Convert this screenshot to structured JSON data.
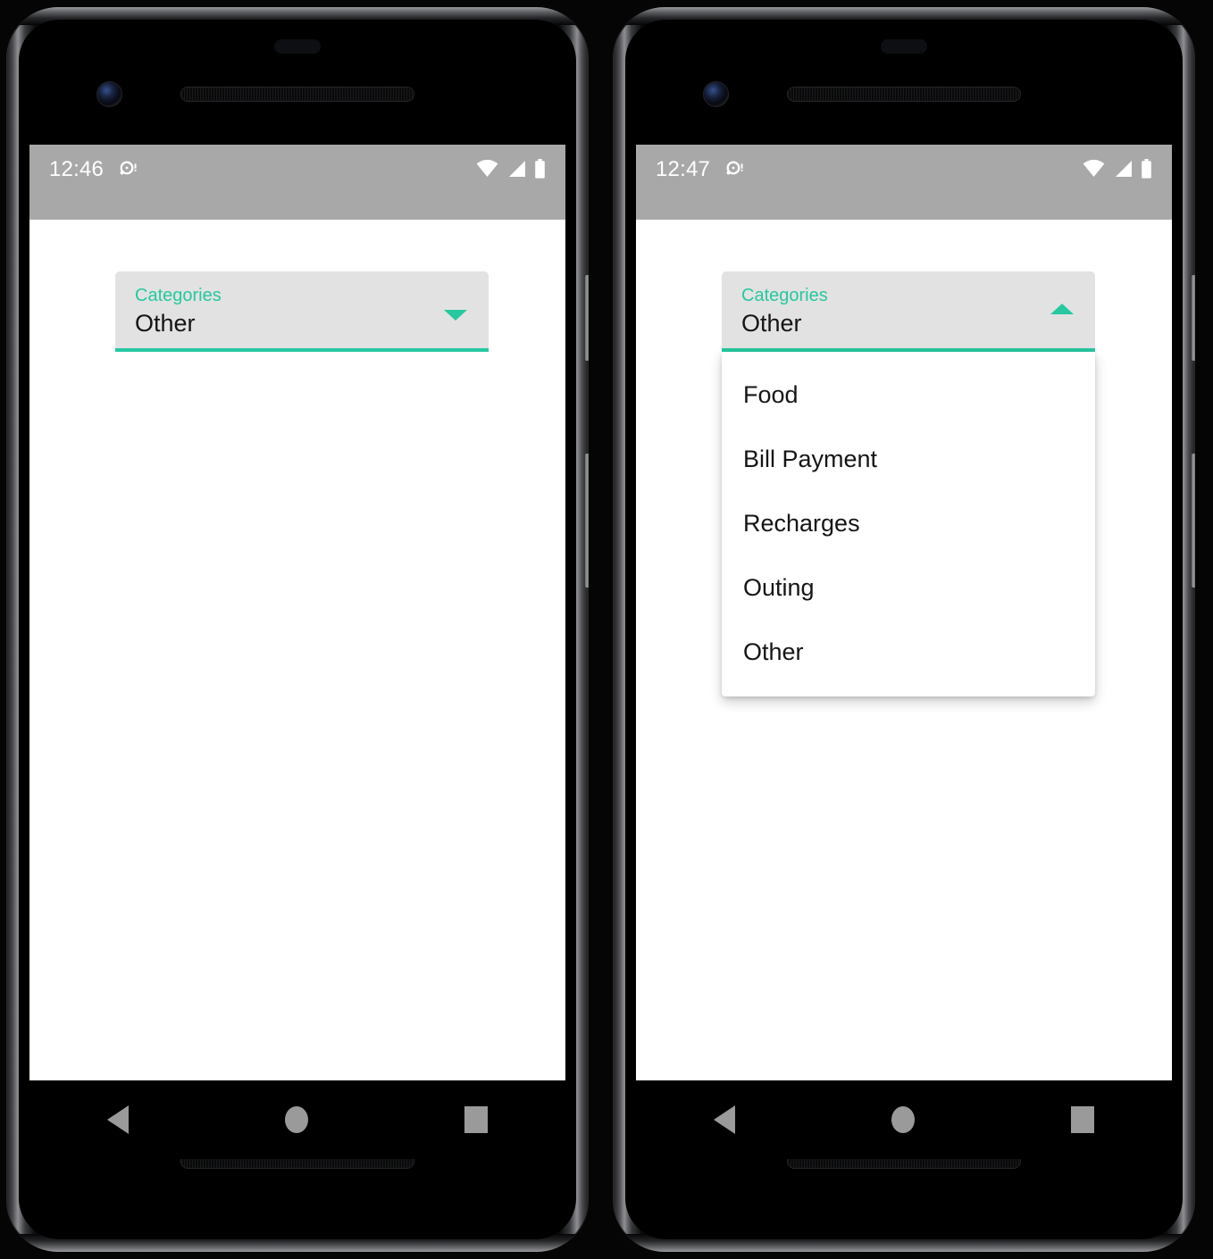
{
  "app": {
    "accent_color": "#26c8a0",
    "field_bg_color": "#e2e2e2",
    "statusbar_color": "#a8a8a8",
    "surface_color": "#ffffff"
  },
  "phones": [
    {
      "id": "left",
      "state_label": "collapsed",
      "status_bar": {
        "time": "12:46",
        "alarm_icon": "alarm-icon",
        "wifi_icon": "wifi-icon",
        "cellular_icon": "cellular-signal-icon",
        "battery_icon": "battery-icon"
      },
      "spinner": {
        "label": "Categories",
        "value": "Other",
        "caret_icon": "chevron-down-icon",
        "expanded": false
      },
      "nav_bar": {
        "back": "back-icon",
        "home": "home-icon",
        "recents": "recents-icon"
      }
    },
    {
      "id": "right",
      "state_label": "expanded",
      "status_bar": {
        "time": "12:47",
        "alarm_icon": "alarm-icon",
        "wifi_icon": "wifi-icon",
        "cellular_icon": "cellular-signal-icon",
        "battery_icon": "battery-icon"
      },
      "spinner": {
        "label": "Categories",
        "value": "Other",
        "caret_icon": "chevron-up-icon",
        "expanded": true,
        "options": [
          "Food",
          "Bill Payment",
          "Recharges",
          "Outing",
          "Other"
        ]
      },
      "nav_bar": {
        "back": "back-icon",
        "home": "home-icon",
        "recents": "recents-icon"
      }
    }
  ]
}
